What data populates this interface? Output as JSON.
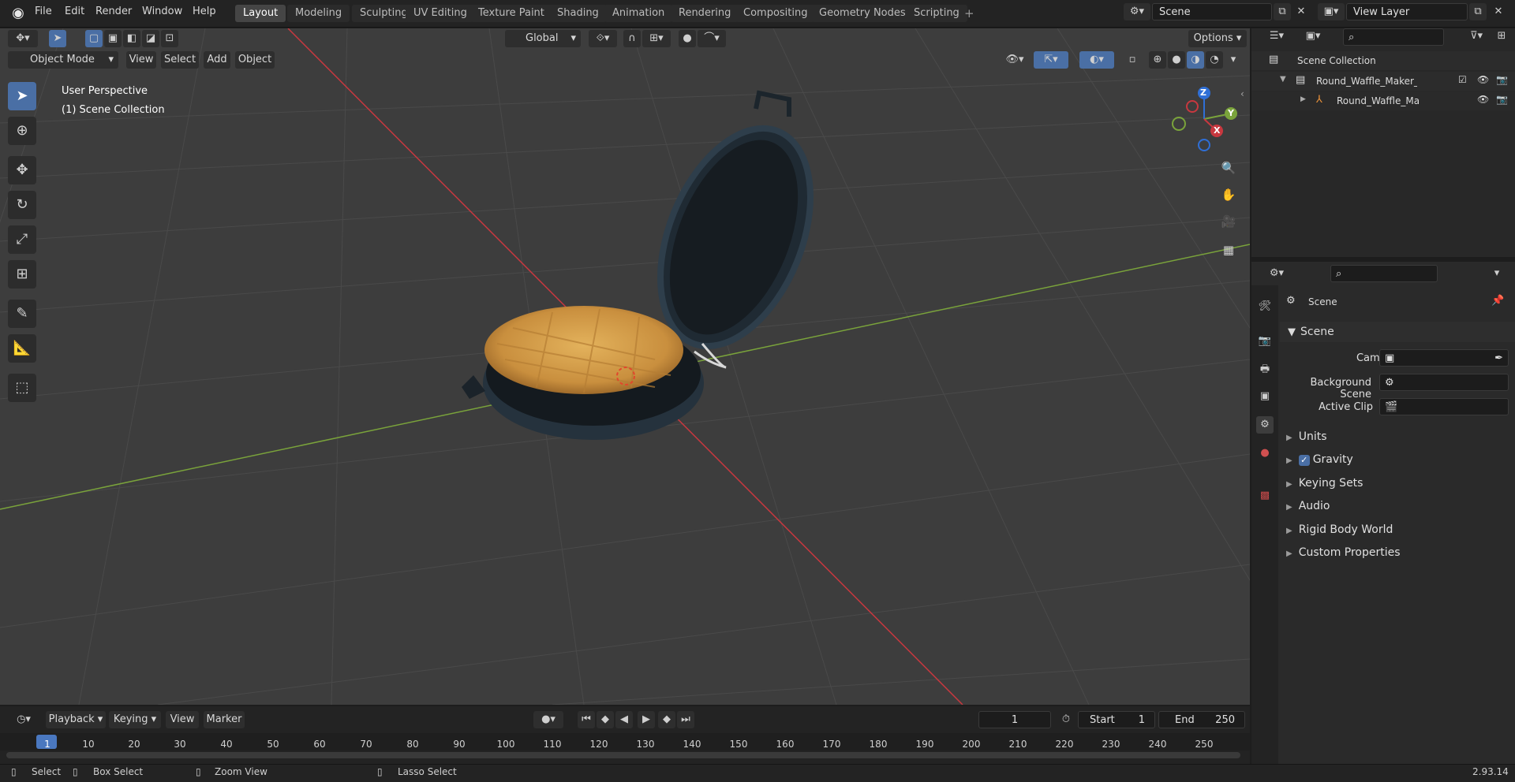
{
  "menus": [
    "File",
    "Edit",
    "Render",
    "Window",
    "Help"
  ],
  "workspaces": [
    "Layout",
    "Modeling",
    "Sculpting",
    "UV Editing",
    "Texture Paint",
    "Shading",
    "Animation",
    "Rendering",
    "Compositing",
    "Geometry Nodes",
    "Scripting"
  ],
  "active_workspace": "Layout",
  "add_workspace": "+",
  "scene_field": "Scene",
  "view_layer_field": "View Layer",
  "viewport": {
    "mode": "Object Mode",
    "menus": [
      "View",
      "Select",
      "Add",
      "Object"
    ],
    "transform_orientation": "Global",
    "options_label": "Options",
    "overlay_line1": "User Perspective",
    "overlay_line2": "(1) Scene Collection",
    "gizmo": {
      "z": "Z",
      "y": "Y",
      "x": "X"
    }
  },
  "outliner": {
    "root": "Scene Collection",
    "items": [
      {
        "label": "Round_Waffle_Maker_with_W"
      },
      {
        "label": "Round_Waffle_Maker_wi"
      }
    ]
  },
  "properties": {
    "context_title": "Scene",
    "panel_title": "Scene",
    "fields": [
      {
        "label": "Camera",
        "value": ""
      },
      {
        "label": "Background Scene",
        "value": ""
      },
      {
        "label": "Active Clip",
        "value": ""
      }
    ],
    "sections": [
      "Units",
      "Gravity",
      "Keying Sets",
      "Audio",
      "Rigid Body World",
      "Custom Properties"
    ],
    "gravity_checked": true
  },
  "timeline": {
    "menus": [
      "Playback",
      "Keying",
      "View",
      "Marker"
    ],
    "current_frame": "1",
    "start_label": "Start",
    "start_value": "1",
    "end_label": "End",
    "end_value": "250",
    "ruler": [
      "1",
      "10",
      "20",
      "30",
      "40",
      "50",
      "60",
      "70",
      "80",
      "90",
      "100",
      "110",
      "120",
      "130",
      "140",
      "150",
      "160",
      "170",
      "180",
      "190",
      "200",
      "210",
      "220",
      "230",
      "240",
      "250"
    ]
  },
  "status": {
    "select": "Select",
    "box_select": "Box Select",
    "zoom_view": "Zoom View",
    "lasso_select": "Lasso Select",
    "version": "2.93.14"
  },
  "colors": {
    "accent": "#4a6fa5",
    "x_axis": "#c8383f",
    "y_axis": "#7aa33b",
    "z_axis": "#2f6fd6"
  }
}
